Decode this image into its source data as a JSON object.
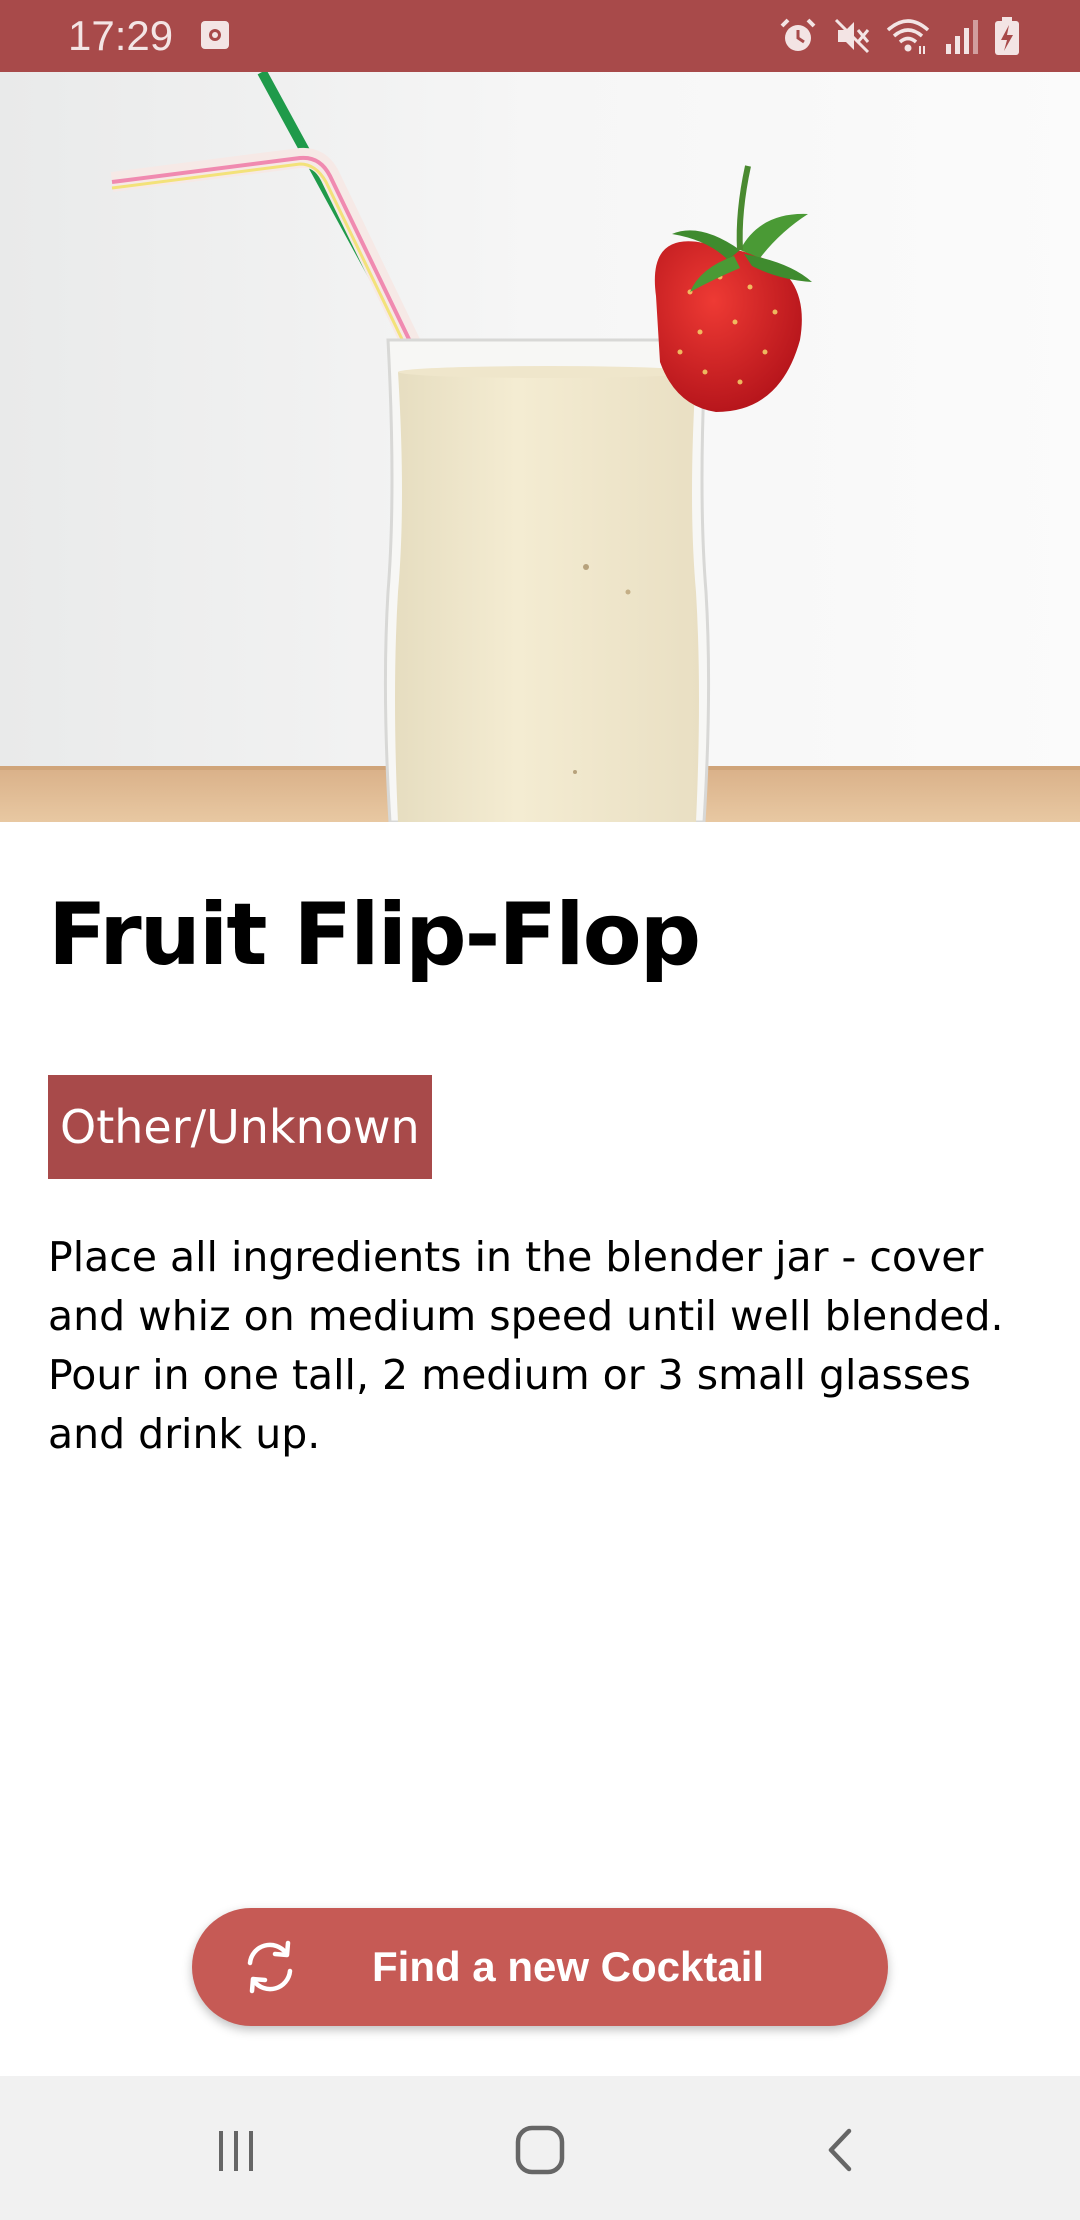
{
  "status_bar": {
    "time": "17:29",
    "icons": [
      "app-notification-icon",
      "alarm-icon",
      "mute-icon",
      "wifi-icon",
      "signal-icon",
      "battery-charging-icon"
    ],
    "background": "#a84a4a"
  },
  "hero": {
    "image": "milkshake-with-straw-and-strawberry"
  },
  "cocktail": {
    "name": "Fruit Flip-Flop",
    "category": "Other/Unknown",
    "instructions": "Place all ingredients in the blender jar - cover and whiz on medium speed until well blended. Pour in one tall, 2 medium or 3 small glasses and drink up."
  },
  "action": {
    "label": "Find a new Cocktail",
    "icon": "refresh-icon",
    "color": "#c65a55"
  },
  "nav_bar": {
    "buttons": [
      "recent-apps-icon",
      "home-icon",
      "back-icon"
    ]
  },
  "colors": {
    "accent": "#a84a4a",
    "button": "#c65a55",
    "text": "#000000"
  }
}
